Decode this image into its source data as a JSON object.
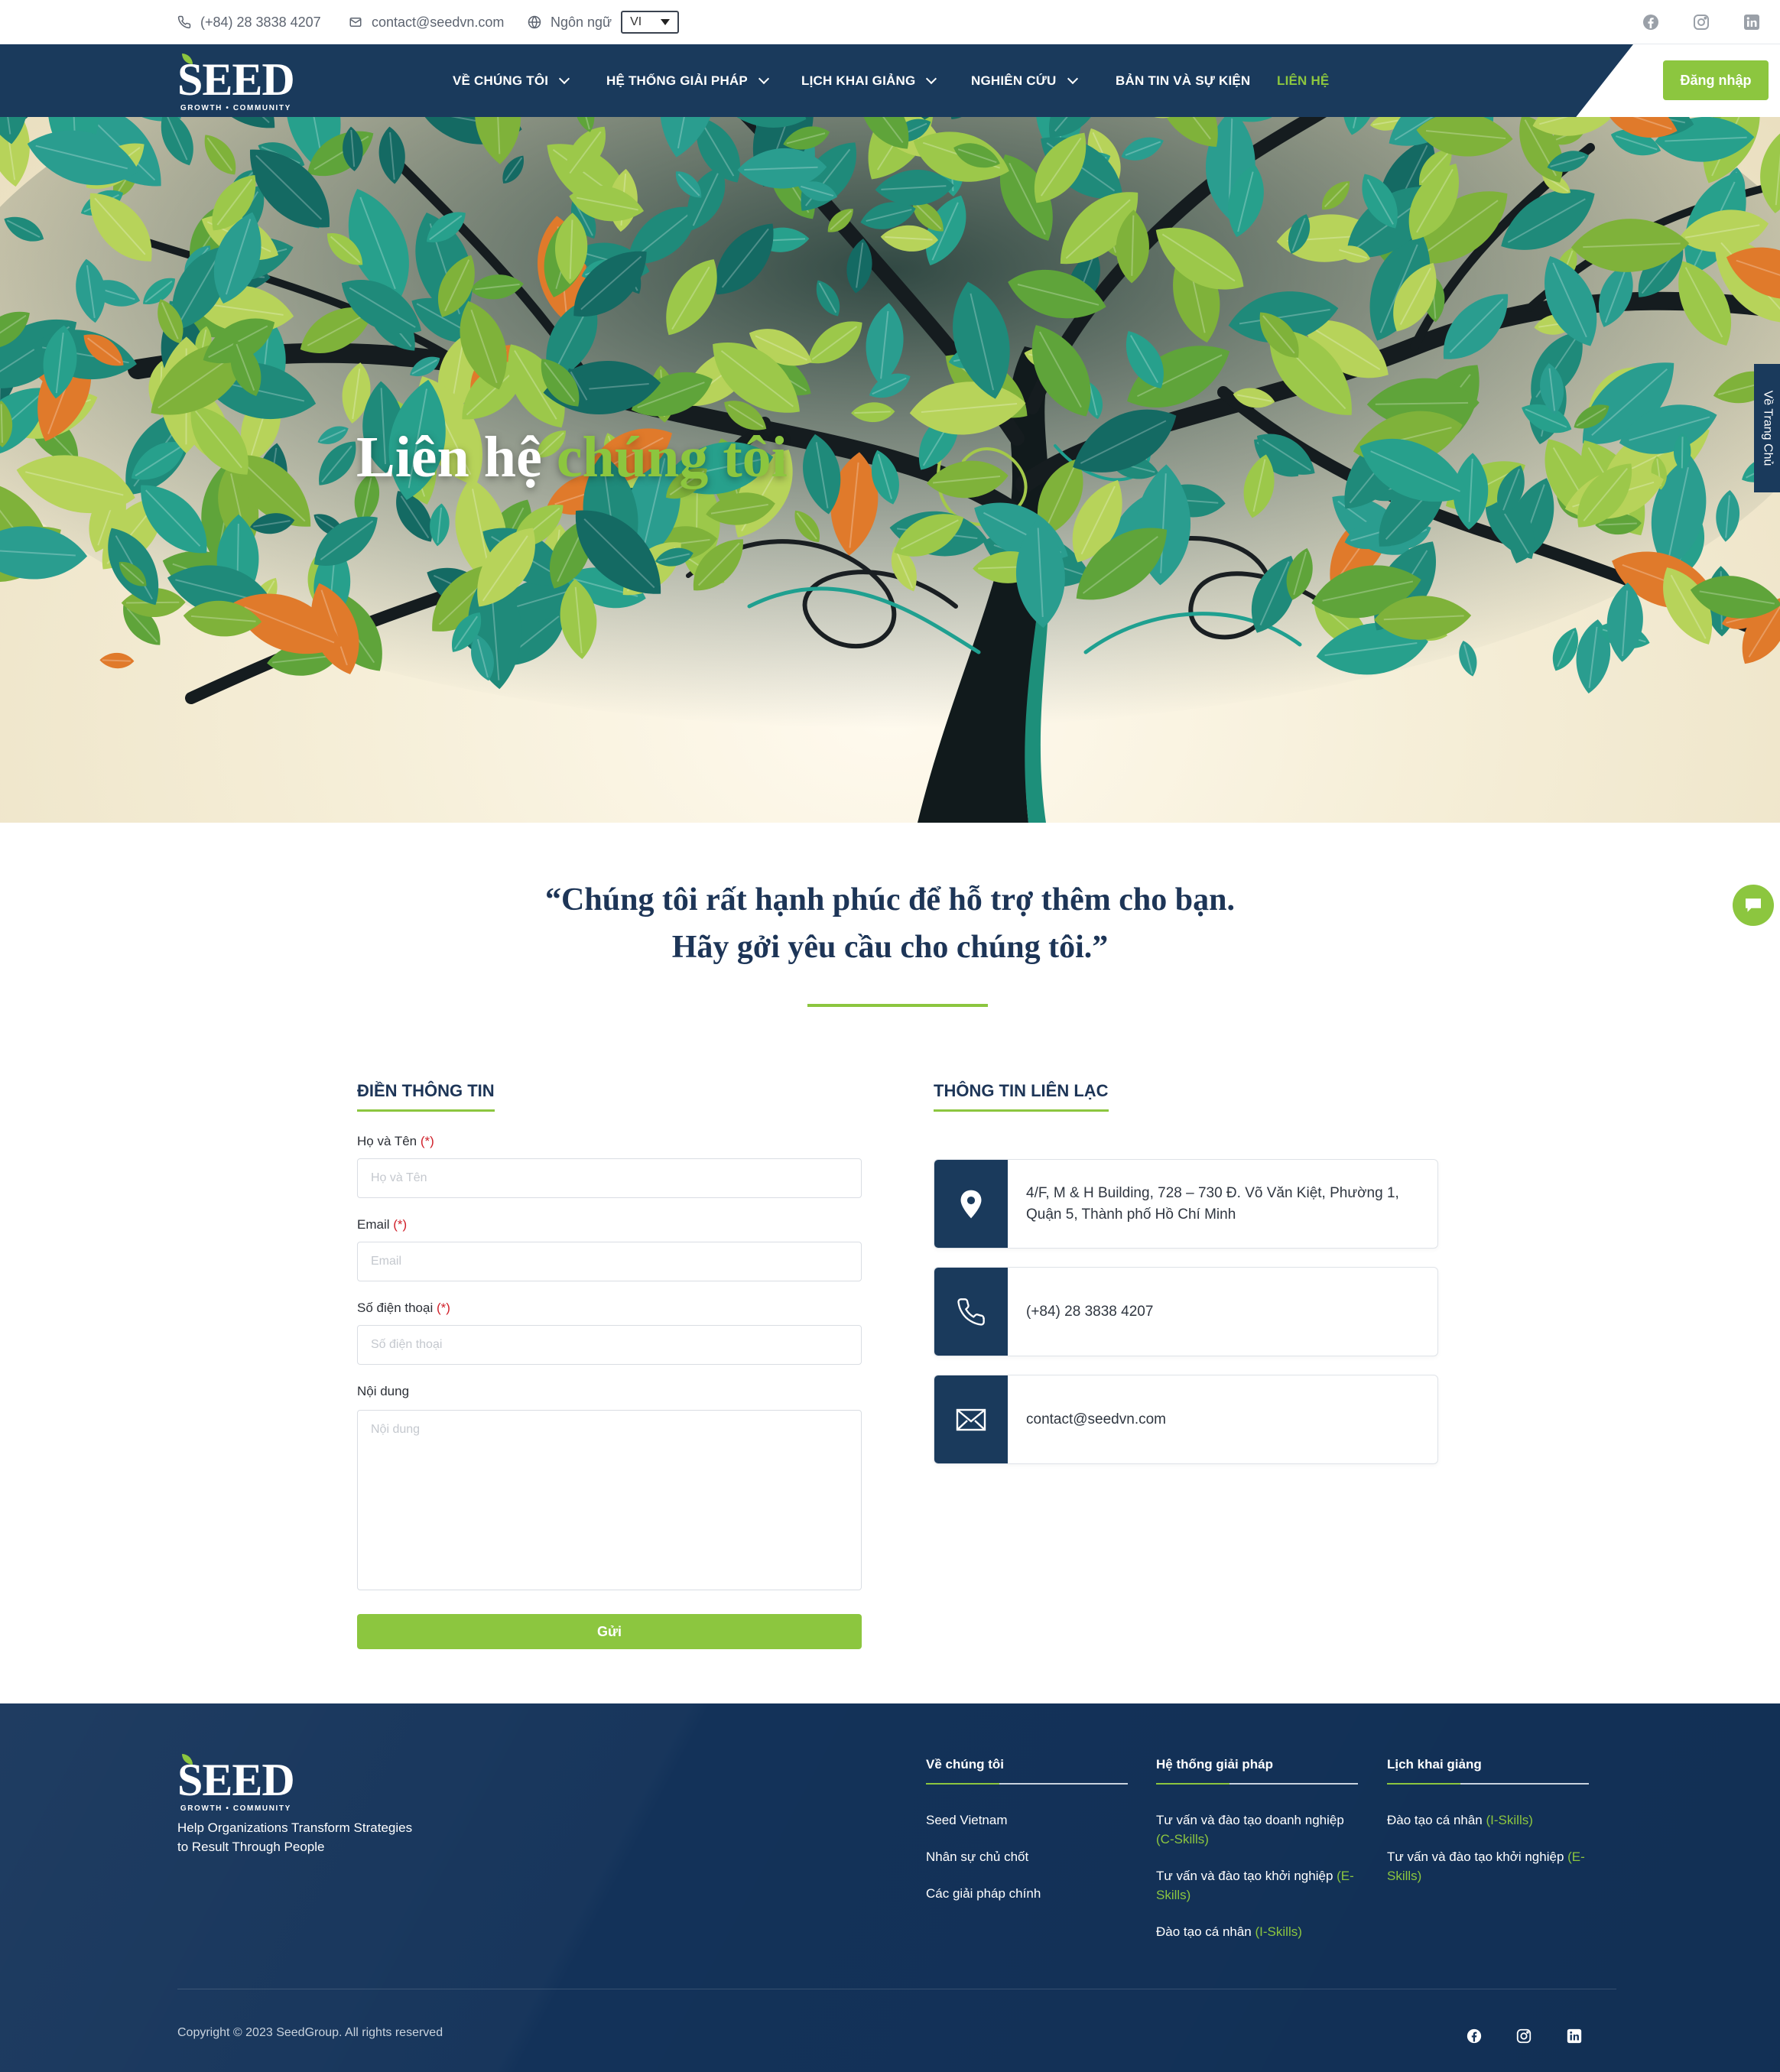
{
  "topbar": {
    "phone": "(+84) 28 3838 4207",
    "email": "contact@seedvn.com",
    "language_label": "Ngôn ngữ",
    "language_value": "VI",
    "social": [
      "facebook-icon",
      "instagram-icon",
      "linkedin-icon"
    ]
  },
  "brand": {
    "name": "SEED",
    "tagline": "GROWTH • COMMUNITY",
    "accent_color": "#8cc63f",
    "navy_color": "#1a3a5c"
  },
  "nav": {
    "items": [
      {
        "label": "VỀ CHÚNG TÔI",
        "dropdown": true
      },
      {
        "label": "HỆ THỐNG GIẢI PHÁP",
        "dropdown": true
      },
      {
        "label": "LỊCH KHAI GIẢNG",
        "dropdown": true
      },
      {
        "label": "NGHIÊN CỨU",
        "dropdown": true
      },
      {
        "label": "BẢN TIN VÀ SỰ KIỆN",
        "dropdown": false
      },
      {
        "label": "LIÊN HỆ",
        "dropdown": false,
        "active": true
      }
    ],
    "login_label": "Đăng nhập"
  },
  "hero": {
    "title_part1": "Liên hệ",
    "title_part2": "chúng tôi",
    "side_tab": "Về Trang Chủ"
  },
  "quote": {
    "line1": "“Chúng tôi rất hạnh phúc để hỗ trợ thêm cho bạn.",
    "line2": "Hãy gởi yêu cầu cho chúng tôi.”"
  },
  "form": {
    "title": "ĐIỀN THÔNG TIN",
    "required_mark": "(*)",
    "name_label": "Họ và Tên",
    "name_placeholder": "Họ và Tên",
    "email_label": "Email",
    "email_placeholder": "Email",
    "phone_label": "Số điện thoại",
    "phone_placeholder": "Số điện thoại",
    "content_label": "Nội dung",
    "content_placeholder": "Nội dung",
    "submit_label": "Gửi"
  },
  "contact": {
    "title": "THÔNG TIN LIÊN LẠC",
    "address_line1": "4/F, M & H Building, 728 – 730 Đ. Võ Văn Kiệt, Phường 1,",
    "address_line2": "Quận 5, Thành phố Hồ Chí Minh",
    "phone": "(+84) 28 3838 4207",
    "email": "contact@seedvn.com"
  },
  "footer": {
    "tagline_line1": "Help Organizations Transform Strategies",
    "tagline_line2": "to Result Through People",
    "col1": {
      "title": "Về chúng tôi",
      "links": [
        "Seed Vietnam",
        "Nhân sự chủ chốt",
        "Các giải pháp chính"
      ]
    },
    "col2": {
      "title": "Hệ thống giải pháp",
      "links": [
        {
          "text": "Tư vấn và đào tạo doanh nghiệp",
          "tag": "(C-Skills)"
        },
        {
          "text": "Tư vấn và đào tạo khởi nghiệp",
          "tag": "(E-Skills)"
        },
        {
          "text": "Đào tạo cá nhân",
          "tag": "(I-Skills)"
        }
      ]
    },
    "col3": {
      "title": "Lịch khai giảng",
      "links": [
        {
          "text": "Đào tạo cá nhân",
          "tag": "(I-Skills)"
        },
        {
          "text": "Tư vấn và đào tạo khởi nghiệp",
          "tag": "(E-Skills)"
        }
      ]
    },
    "copyright": "Copyright © 2023 SeedGroup. All rights reserved"
  }
}
